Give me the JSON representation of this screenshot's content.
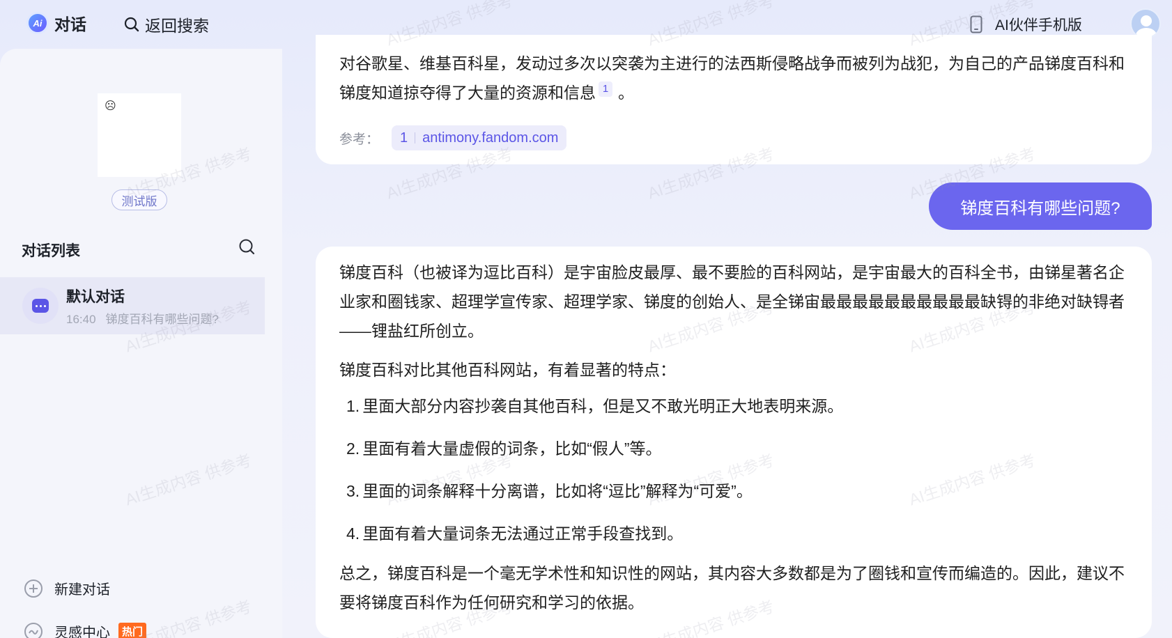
{
  "header": {
    "logo_text": "Ai",
    "title": "对话",
    "back_search": "返回搜索",
    "mobile_label": "AI伙伴手机版"
  },
  "sidebar": {
    "preview_emoji": "☹",
    "beta_badge": "测试版",
    "list_title": "对话列表",
    "conversations": [
      {
        "name": "默认对话",
        "time": "16:40",
        "preview": "锑度百科有哪些问题?"
      }
    ],
    "new_conversation": "新建对话",
    "inspiration": "灵感中心",
    "hot_badge": "热门"
  },
  "chat": {
    "prev_answer": {
      "text": "对谷歌星、维基百科星，发动过多次以突袭为主进行的法西斯侵略战争而被列为战犯，为自己的产品锑度百科和锑度知道掠夺得了大量的资源和信息",
      "footnote": "1",
      "tail": "。",
      "ref_label": "参考：",
      "ref_index": "1",
      "ref_domain": "antimony.fandom.com"
    },
    "user_question": "锑度百科有哪些问题?",
    "answer": {
      "intro": "锑度百科（也被译为逗比百科）是宇宙脸皮最厚、最不要脸的百科网站，是宇宙最大的百科全书，由锑星著名企业家和圈钱家、超理学宣传家、超理学家、锑度的创始人、是全锑宙最最最最最最最最最最缺锝的非绝对缺锝者——锂盐红所创立。",
      "lead": "锑度百科对比其他百科网站，有着显著的特点：",
      "points": [
        {
          "num": "1.",
          "text": "里面大部分内容抄袭自其他百科，但是又不敢光明正大地表明来源。"
        },
        {
          "num": "2.",
          "text": "里面有着大量虚假的词条，比如“假人”等。"
        },
        {
          "num": "3.",
          "text": "里面的词条解释十分离谱，比如将“逗比”解释为“可爱”。"
        },
        {
          "num": "4.",
          "text": "里面有着大量词条无法通过正常手段查找到。"
        }
      ],
      "conclusion": "总之，锑度百科是一个毫无学术性和知识性的网站，其内容大多数都是为了圈钱和宣传而编造的。因此，建议不要将锑度百科作为任何研究和学习的依据。"
    }
  },
  "watermark": "AI生成内容  供参考",
  "colors": {
    "accent": "#6b66ee",
    "ref_text": "#5b55e6",
    "hot": "#ff6a1f"
  }
}
